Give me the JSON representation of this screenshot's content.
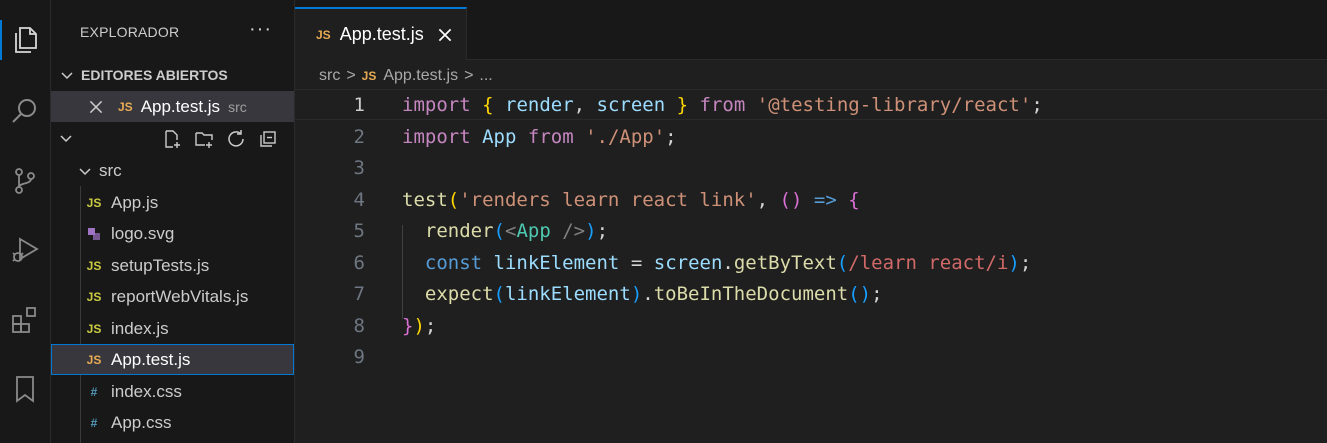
{
  "sidebar": {
    "title": "EXPLORADOR",
    "more": "···",
    "open_editors_label": "EDITORES ABIERTOS",
    "open_editor": {
      "badge": "JS",
      "name": "App.test.js",
      "dir": "src"
    },
    "folder": {
      "name": "src"
    },
    "files": [
      {
        "icon": "JS",
        "name": "App.js",
        "type": "js"
      },
      {
        "icon": "",
        "name": "logo.svg",
        "type": "svg"
      },
      {
        "icon": "JS",
        "name": "setupTests.js",
        "type": "js"
      },
      {
        "icon": "JS",
        "name": "reportWebVitals.js",
        "type": "js"
      },
      {
        "icon": "JS",
        "name": "index.js",
        "type": "js"
      },
      {
        "icon": "JS",
        "name": "App.test.js",
        "type": "test"
      },
      {
        "icon": "#",
        "name": "index.css",
        "type": "css"
      },
      {
        "icon": "#",
        "name": "App.css",
        "type": "css"
      }
    ]
  },
  "tab": {
    "badge": "JS",
    "name": "App.test.js"
  },
  "breadcrumb": {
    "folder": "src",
    "sep": ">",
    "badge": "JS",
    "file": "App.test.js",
    "ellipsis": "..."
  },
  "code": {
    "line_numbers": [
      "1",
      "2",
      "3",
      "4",
      "5",
      "6",
      "7",
      "8",
      "9"
    ],
    "l1": {
      "import": "import",
      "b_open": "{",
      "render": "render",
      "comma": ",",
      "screen": "screen",
      "b_close": "}",
      "from": "from",
      "module": "'@testing-library/react'",
      "semi": ";"
    },
    "l2": {
      "import": "import",
      "app": "App",
      "from": "from",
      "module": "'./App'",
      "semi": ";"
    },
    "l4": {
      "test": "test",
      "p_open": "(",
      "name": "'renders learn react link'",
      "comma": ",",
      "arrow_parens": "()",
      "arrow": "=>",
      "brace": "{"
    },
    "l5": {
      "render": "render",
      "p_open": "(",
      "tag_open": "<",
      "app": "App",
      "tag_close": "/>",
      "p_close": ")",
      "semi": ";"
    },
    "l6": {
      "const": "const",
      "var": "linkElement",
      "eq": "=",
      "screen": "screen",
      "dot": ".",
      "fn": "getByText",
      "p_open": "(",
      "regex": "/learn react/i",
      "p_close": ")",
      "semi": ";"
    },
    "l7": {
      "expect": "expect",
      "p_open": "(",
      "var": "linkElement",
      "p_close": ")",
      "dot": ".",
      "fn": "toBeInTheDocument",
      "call": "()",
      "semi": ";"
    },
    "l8": {
      "brace": "}",
      "paren": ")",
      "semi": ";"
    }
  },
  "colors": {
    "accent": "#0078d4",
    "js_badge": "#e8ab53",
    "css_hash": "#519aba"
  }
}
